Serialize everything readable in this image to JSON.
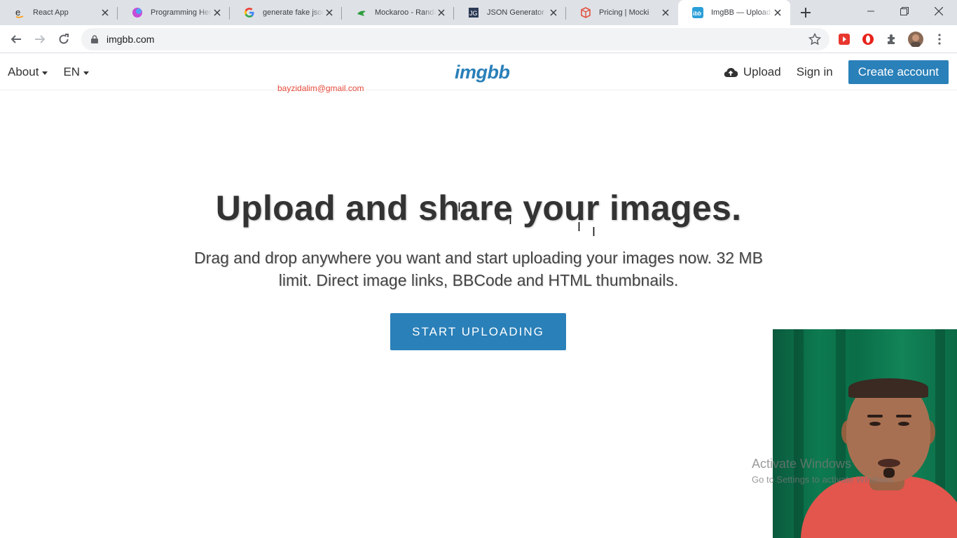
{
  "browser": {
    "tabs": [
      {
        "title": "React App",
        "icon": "amazon-e-icon",
        "active": false
      },
      {
        "title": "Programming Hero",
        "icon": "programming-hero-icon",
        "active": false
      },
      {
        "title": "generate fake json",
        "icon": "google-icon",
        "active": false
      },
      {
        "title": "Mockaroo - Random",
        "icon": "mockaroo-icon",
        "active": false
      },
      {
        "title": "JSON Generator – T",
        "icon": "json-generator-icon",
        "active": false
      },
      {
        "title": "Pricing | Mocki",
        "icon": "mocki-icon",
        "active": false
      },
      {
        "title": "ImgBB — Upload Im",
        "icon": "imgbb-icon",
        "active": true
      }
    ],
    "address": "imgbb.com"
  },
  "header": {
    "about_label": "About",
    "lang_label": "EN",
    "logo_text": "imgbb",
    "upload_label": "Upload",
    "signin_label": "Sign in",
    "create_label": "Create account",
    "email": "bayzidalim@gmail.com"
  },
  "hero": {
    "title": "Upload and share your images.",
    "subtitle": "Drag and drop anywhere you want and start uploading your images now. 32 MB limit. Direct image links, BBCode and HTML thumbnails.",
    "button_label": "START UPLOADING"
  },
  "watermark": {
    "line1": "Activate Windows",
    "line2": "Go to Settings to activate Windows."
  },
  "colors": {
    "accent": "#2a80b9",
    "email": "#e74c3c"
  }
}
